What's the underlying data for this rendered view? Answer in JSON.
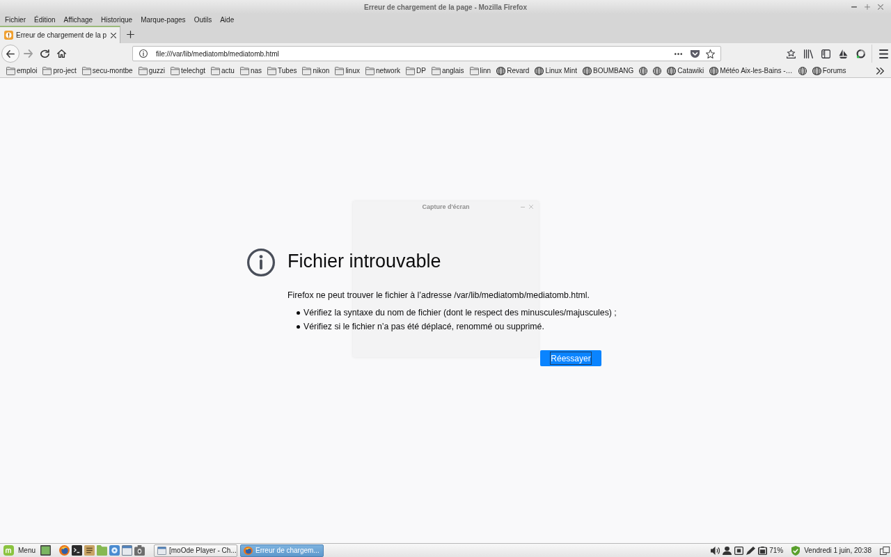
{
  "window": {
    "title": "Erreur de chargement de la page - Mozilla Firefox"
  },
  "menu_bar": [
    {
      "label": "Fichier"
    },
    {
      "label": "Édition"
    },
    {
      "label": "Affichage"
    },
    {
      "label": "Historique"
    },
    {
      "label": "Marque-pages"
    },
    {
      "label": "Outils"
    },
    {
      "label": "Aide"
    }
  ],
  "tabs": [
    {
      "label": "Erreur de chargement de la p",
      "selected": true
    }
  ],
  "nav_buttons": [
    {
      "kind": "back",
      "disabled": false
    },
    {
      "kind": "forward",
      "disabled": true
    },
    {
      "kind": "reload",
      "disabled": false
    },
    {
      "kind": "home",
      "disabled": false
    }
  ],
  "address_bar": {
    "value": "file:///var/lib/mediatomb/mediatomb.html"
  },
  "bookmarks": [
    {
      "kind": "folder",
      "label": "emploi"
    },
    {
      "kind": "folder",
      "label": "pro-ject"
    },
    {
      "kind": "folder",
      "label": "secu-montbe"
    },
    {
      "kind": "folder",
      "label": "guzzi"
    },
    {
      "kind": "folder",
      "label": "telechgt"
    },
    {
      "kind": "folder",
      "label": "actu"
    },
    {
      "kind": "folder",
      "label": "nas"
    },
    {
      "kind": "folder",
      "label": "Tubes"
    },
    {
      "kind": "folder",
      "label": "nikon"
    },
    {
      "kind": "folder",
      "label": "linux"
    },
    {
      "kind": "folder",
      "label": "network"
    },
    {
      "kind": "folder",
      "label": "DP"
    },
    {
      "kind": "folder",
      "label": "anglais"
    },
    {
      "kind": "folder",
      "label": "linn"
    },
    {
      "kind": "site",
      "label": "Revard"
    },
    {
      "kind": "site",
      "label": "Linux Mint"
    },
    {
      "kind": "site",
      "label": "BOUMBANG"
    },
    {
      "kind": "site"
    },
    {
      "kind": "site"
    },
    {
      "kind": "site",
      "label": "Catawiki"
    },
    {
      "kind": "site",
      "label": "Météo Aix-les-Bains -…"
    },
    {
      "kind": "site"
    },
    {
      "kind": "site",
      "label": "Forums"
    }
  ],
  "ghost_window": {
    "title": "Capture d'écran"
  },
  "error_page": {
    "title": "Fichier introuvable",
    "message": "Firefox ne peut trouver le fichier à l’adresse /var/lib/mediatomb/mediatomb.html.",
    "suggestions": [
      "Vérifiez la syntaxe du nom de fichier (dont le respect des minuscules/majuscules) ;",
      "Vérifiez si le fichier n’a pas été déplacé, renommé ou supprimé."
    ],
    "button": "Réessayer"
  },
  "taskbar": {
    "menu_label": "Menu",
    "tasks": [
      {
        "label": "[moOde Player - Ch...",
        "selected": false
      },
      {
        "label": "Erreur de chargem...",
        "selected": true
      }
    ],
    "battery": "71%",
    "clock": "Vendredi 1 juin, 20:38"
  }
}
